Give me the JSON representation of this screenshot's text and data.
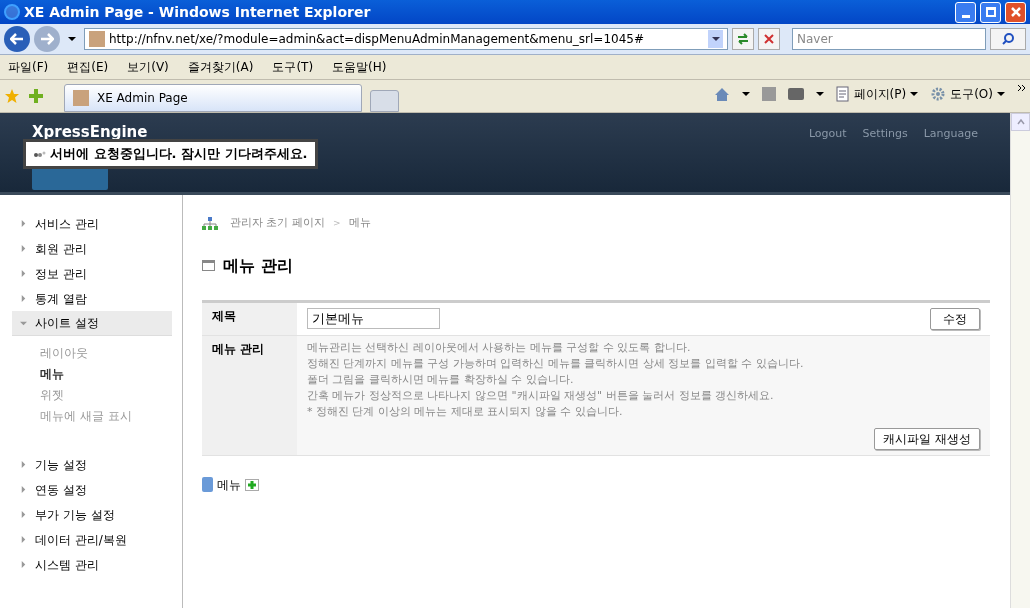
{
  "window": {
    "title": "XE Admin Page - Windows Internet Explorer"
  },
  "address_bar": {
    "url": "http://nfnv.net/xe/?module=admin&act=dispMenuAdminManagement&menu_srl=1045#"
  },
  "search": {
    "placeholder": "Naver"
  },
  "menu_bar": [
    "파일(F)",
    "편집(E)",
    "보기(V)",
    "즐겨찾기(A)",
    "도구(T)",
    "도움말(H)"
  ],
  "tabs": [
    {
      "label": "XE Admin Page",
      "selected": true
    }
  ],
  "command_bar": [
    {
      "label": "페이지(P)"
    },
    {
      "label": "도구(O)"
    }
  ],
  "header": {
    "logo": "XpressEngine",
    "links": [
      "Logout",
      "Settings",
      "Language"
    ]
  },
  "toast": {
    "text": "서버에 요청중입니다. 잠시만 기다려주세요."
  },
  "sidebar": {
    "items": [
      {
        "label": "서비스 관리",
        "expanded": false
      },
      {
        "label": "회원 관리",
        "expanded": false
      },
      {
        "label": "정보 관리",
        "expanded": false
      },
      {
        "label": "통계 열람",
        "expanded": false
      },
      {
        "label": "사이트 설정",
        "expanded": true,
        "children": [
          {
            "label": "레이아웃",
            "selected": false
          },
          {
            "label": "메뉴",
            "selected": true
          },
          {
            "label": "위젯",
            "selected": false
          },
          {
            "label": "메뉴에 새글 표시",
            "selected": false
          }
        ]
      },
      {
        "label": "기능 설정",
        "expanded": false
      },
      {
        "label": "연동 설정",
        "expanded": false
      },
      {
        "label": "부가 기능 설정",
        "expanded": false
      },
      {
        "label": "데이터 관리/복원",
        "expanded": false
      },
      {
        "label": "시스템 관리",
        "expanded": false
      }
    ]
  },
  "breadcrumb": [
    "관리자 초기 페이지",
    ">",
    "메뉴"
  ],
  "page_title": "메뉴 관리",
  "form": {
    "title_label": "제목",
    "title_value": "기본메뉴",
    "save_button": "수정",
    "info_label": "메뉴 관리",
    "info_lines": [
      "메뉴관리는 선택하신 레이아웃에서 사용하는 메뉴를 구성할 수 있도록 합니다.",
      "정해진 단계까지 메뉴를 구성 가능하며 입력하신 메뉴를 클릭하시면 상세 정보를 입력할 수 있습니다.",
      "폴더 그림을 클릭하시면 메뉴를 확장하실 수 있습니다.",
      "간혹 메뉴가 정상적으로 나타나지 않으면 \"캐시파일 재생성\" 버튼을 눌러서 정보를 갱신하세요.",
      "* 정해진 단계 이상의 메뉴는 제대로 표시되지 않을 수 있습니다."
    ],
    "cache_button": "캐시파일 재생성"
  },
  "menu_tree": {
    "root": "메뉴"
  }
}
